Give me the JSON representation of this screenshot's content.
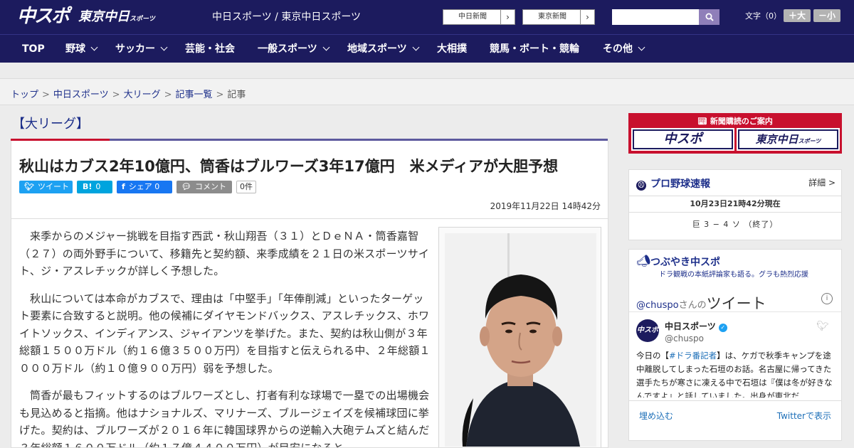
{
  "header": {
    "logo_chuspo": "中スポ",
    "logo_tokyo": "東京中日",
    "logo_tokyo_sub": "スポーツ",
    "site_name": "中日スポーツ / 東京中日スポーツ",
    "ext_links": [
      "中日新聞",
      "東京新聞"
    ],
    "search_placeholder": "",
    "font_size_label": "文字（0）",
    "font_bigger": "＋大",
    "font_smaller": "－小"
  },
  "nav": [
    {
      "label": "TOP",
      "dropdown": false
    },
    {
      "label": "野球",
      "dropdown": true
    },
    {
      "label": "サッカー",
      "dropdown": true
    },
    {
      "label": "芸能・社会",
      "dropdown": false
    },
    {
      "label": "一般スポーツ",
      "dropdown": true
    },
    {
      "label": "地域スポーツ",
      "dropdown": true
    },
    {
      "label": "大相撲",
      "dropdown": false
    },
    {
      "label": "競馬・ボート・競輪",
      "dropdown": false
    },
    {
      "label": "その他",
      "dropdown": true
    }
  ],
  "breadcrumb": {
    "links": [
      "トップ",
      "中日スポーツ",
      "大リーグ",
      "記事一覧"
    ],
    "current": "記事",
    "separator": ">"
  },
  "category": "【大リーグ】",
  "article": {
    "headline": "秋山はカブス2年10億円、筒香はブルワーズ3年17億円　米メディアが大胆予想",
    "share": {
      "tweet": "ツイート",
      "hatena_icon": "B!",
      "hatena_count": "0",
      "facebook": "シェア",
      "facebook_count": "0",
      "comment": "コメント",
      "comment_count": "0件"
    },
    "date": "2019年11月22日 14時42分",
    "paragraphs": [
      "来季からのメジャー挑戦を目指す西武・秋山翔吾（３１）とＤｅＮＡ・筒香嘉智（２７）の両外野手について、移籍先と契約額、来季成績を２１日の米スポーツサイト、ジ・アスレチックが詳しく予想した。",
      "秋山については本命がカブスで、理由は「中堅手」「年俸削減」といったターゲット要素に合致すると説明。他の候補にダイヤモンドバックス、アスレチックス、ホワイトソックス、インディアンス、ジャイアンツを挙げた。また、契約は秋山側が３年総額１５００万ドル（約１６億３５００万円）を目指すと伝えられる中、２年総額１０００万ドル（約１０億９００万円）弱を予想した。",
      "筒香が最もフィットするのはブルワーズとし、打者有利な球場で一塁での出場機会も見込めると指摘。他はナショナルズ、マリナーズ、ブルージェイズを候補球団に挙げた。契約は、ブルワーズが２０１６年に韓国球界からの逆輸入大砲テムズと結んだ３年総額１６００万ドル（約１７億４４００万円）が目安になると"
    ]
  },
  "sidebar": {
    "subscribe_label": "新聞購読のご案内",
    "subscribe_logos": [
      "中スポ",
      "東京中日"
    ],
    "subscribe_logo_sub": "スポーツ",
    "baseball": {
      "title": "プロ野球速報",
      "more": "詳細 >",
      "time": "10月23日21時42分現在",
      "game": "巨 3 − 4 ソ （終了）"
    },
    "tweets": {
      "title": "つぶやき中スポ",
      "subtitle": "ドラ観戦の本紙評論家も語る。グラも熱烈応援",
      "handle_link": "@chuspo",
      "handle_suffix": "さんの",
      "heading": "ツイート",
      "info": "i",
      "account_name": "中日スポーツ",
      "account_handle": "@chuspo",
      "avatar_text": "中スポ",
      "text_prefix": "今日の【",
      "hashtag": "#ドラ番記者",
      "text_body": "】は、ケガで秋季キャンプを途中離脱してしまった石垣のお話。名古屋に帰ってきた選手たちが寒さに凍える中で石垣は『僕は冬が好きなんですよ』と話していました。出身が東北だ",
      "embed": "埋め込む",
      "view_on": "Twitterで表示"
    }
  },
  "colors": {
    "header_bg": "#1c1b5e",
    "accent_red": "#c8102e",
    "link_blue": "#1d2f8a",
    "twitter_blue": "#1da1f2",
    "facebook_blue": "#1877f2",
    "hatena_blue": "#00a4de",
    "comment_gray": "#8c8c8c"
  }
}
